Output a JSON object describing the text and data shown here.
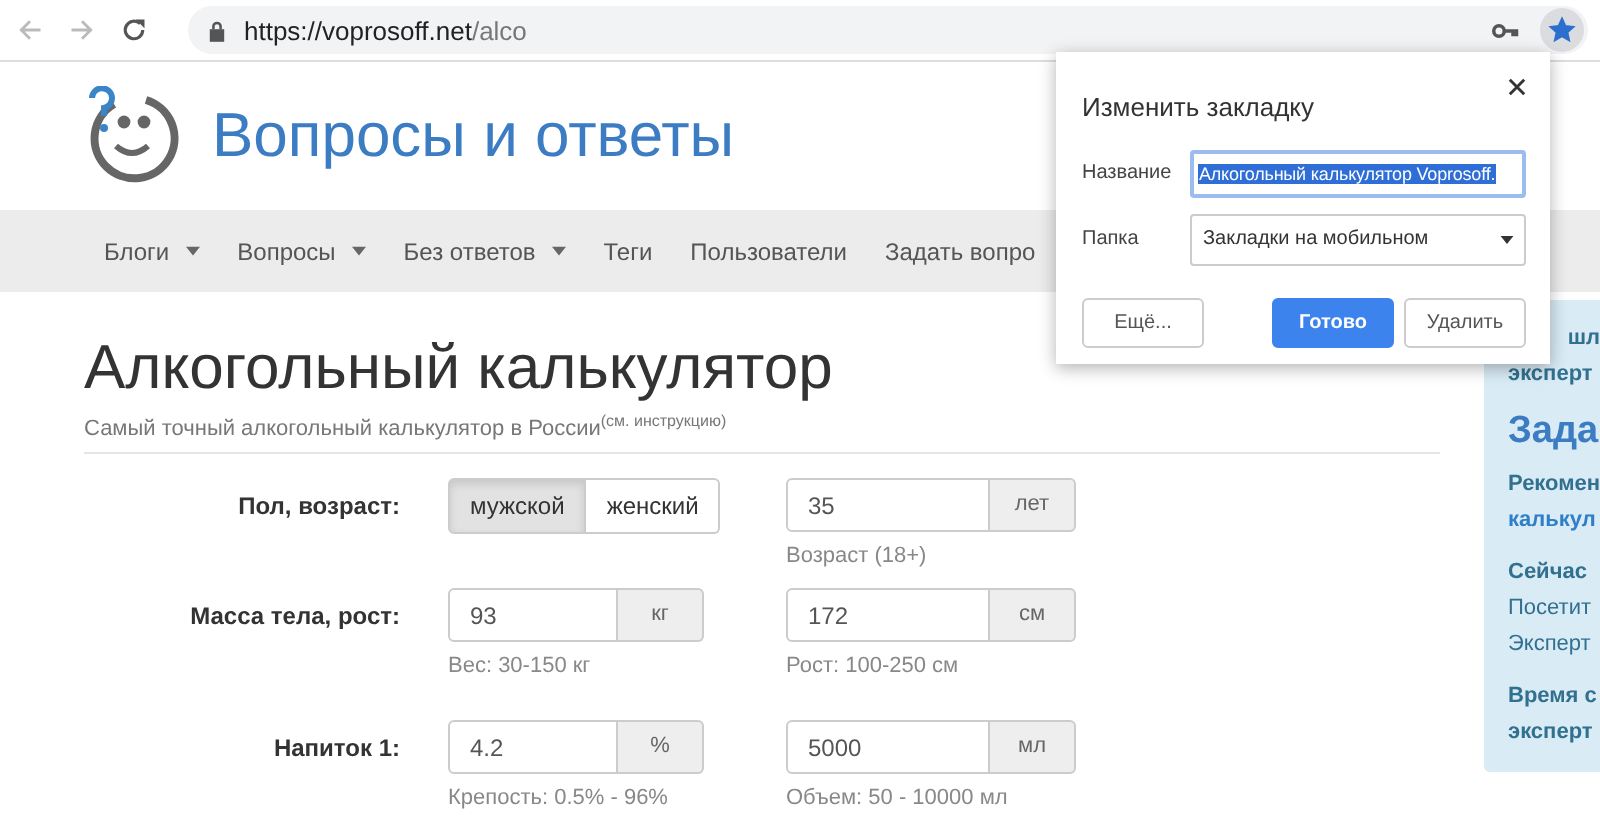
{
  "browser": {
    "url_host": "https://voprosoff.net",
    "url_path": "/alco",
    "bookmarked": true
  },
  "site": {
    "title": "Вопросы и ответы",
    "nav": [
      {
        "label": "Блоги",
        "dropdown": true
      },
      {
        "label": "Вопросы",
        "dropdown": true
      },
      {
        "label": "Без ответов",
        "dropdown": true
      },
      {
        "label": "Теги",
        "dropdown": false
      },
      {
        "label": "Пользователи",
        "dropdown": false
      },
      {
        "label": "Задать вопро",
        "dropdown": false
      }
    ]
  },
  "page": {
    "title": "Алкогольный калькулятор",
    "subtitle": "Самый точный алкогольный калькулятор в России$^{(см. инструкцию)}$",
    "rows": [
      {
        "label": "Пол, возраст:",
        "cells": [
          {
            "kind": "toggle",
            "options": [
              {
                "label": "мужской",
                "selected": true
              },
              {
                "label": "женский",
                "selected": false
              }
            ]
          },
          {
            "kind": "input",
            "value": "35",
            "unit": "лет",
            "hint": "Возраст (18+)"
          }
        ]
      },
      {
        "label": "Масса тела, рост:",
        "cells": [
          {
            "kind": "input",
            "value": "93",
            "unit": "кг",
            "hint": "Вес: 30-150 кг"
          },
          {
            "kind": "input",
            "value": "172",
            "unit": "см",
            "hint": "Рост: 100-250 см"
          }
        ]
      },
      {
        "label": "Напиток 1:",
        "cells": [
          {
            "kind": "input",
            "value": "4.2",
            "unit": "%",
            "hint": "Крепость: 0.5% - 96%"
          },
          {
            "kind": "input",
            "value": "5000",
            "unit": "мл",
            "hint": "Объем: 50 - 10000 мл"
          }
        ]
      }
    ]
  },
  "sidebar": {
    "lines": [
      {
        "text": "шл",
        "kind": "bold"
      },
      {
        "text": "эксперт",
        "kind": "bold"
      },
      {
        "text": "Зада",
        "kind": "heading"
      },
      {
        "text": "Рекомен",
        "kind": "bold"
      },
      {
        "text": "калькул",
        "kind": "link"
      },
      {
        "text": "Сейчас",
        "kind": "bold"
      },
      {
        "text": "Посетит",
        "kind": "plain"
      },
      {
        "text": "Эксперт",
        "kind": "plain"
      },
      {
        "text": "Время с",
        "kind": "bold"
      },
      {
        "text": "эксперт",
        "kind": "bold"
      }
    ]
  },
  "bookmark_popup": {
    "title": "Изменить закладку",
    "name": {
      "label": "Название",
      "value": "Алкогольный калькулятор Voprosoff.",
      "text_selected": true
    },
    "folder": {
      "label": "Папка",
      "value": "Закладки на мобильном"
    },
    "buttons": [
      {
        "label": "Ещё...",
        "kind": "default"
      },
      {
        "label": "Готово",
        "kind": "primary"
      },
      {
        "label": "Удалить",
        "kind": "default"
      }
    ]
  }
}
